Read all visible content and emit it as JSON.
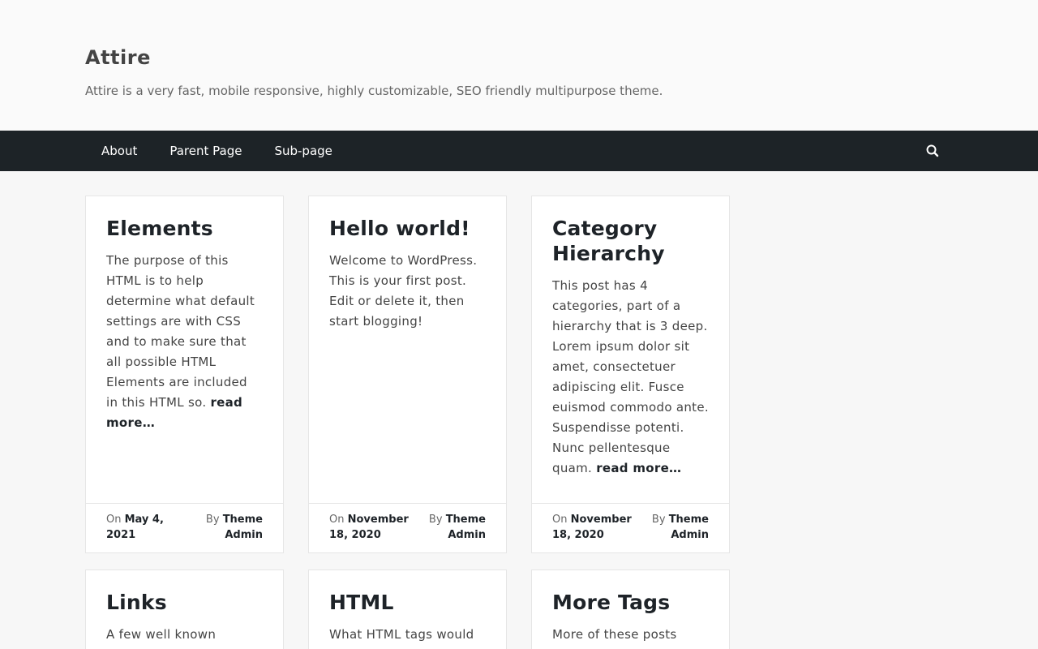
{
  "site": {
    "title": "Attire",
    "description": "Attire is a very fast, mobile responsive, highly customizable, SEO friendly multipurpose theme."
  },
  "nav": {
    "items": [
      "About",
      "Parent Page",
      "Sub-page"
    ],
    "search_icon": "search-icon"
  },
  "colors": {
    "nav_bg": "#1d2327",
    "page_bg": "#f7f7f7",
    "card_bg": "#ffffff"
  },
  "posts": [
    {
      "title": "Elements",
      "excerpt": "The purpose of this HTML is to help determine what default settings are with CSS and to make sure that all possible HTML Elements are included in this HTML so.",
      "read_more": "read more…",
      "date_prefix": "On",
      "date": "May 4, 2021",
      "author_prefix": "By",
      "author": "Theme Admin"
    },
    {
      "title": "Hello world!",
      "excerpt": "Welcome to WordPress. This is your first post. Edit or delete it, then start blogging!",
      "read_more": "",
      "date_prefix": "On",
      "date": "November 18, 2020",
      "author_prefix": "By",
      "author": "Theme Admin"
    },
    {
      "title": "Category Hierarchy",
      "excerpt": "This post has 4 categories, part of a hierarchy that is 3 deep. Lorem ipsum dolor sit amet, consectetuer adipiscing elit. Fusce euismod commodo ante. Suspendisse potenti. Nunc pellentesque quam.",
      "read_more": "read more…",
      "date_prefix": "On",
      "date": "November 18, 2020",
      "author_prefix": "By",
      "author": "Theme Admin"
    },
    {
      "title": "Links",
      "excerpt": "A few well known"
    },
    {
      "title": "HTML",
      "excerpt": "What HTML tags would"
    },
    {
      "title": "More Tags",
      "excerpt": "More of these posts need"
    }
  ]
}
